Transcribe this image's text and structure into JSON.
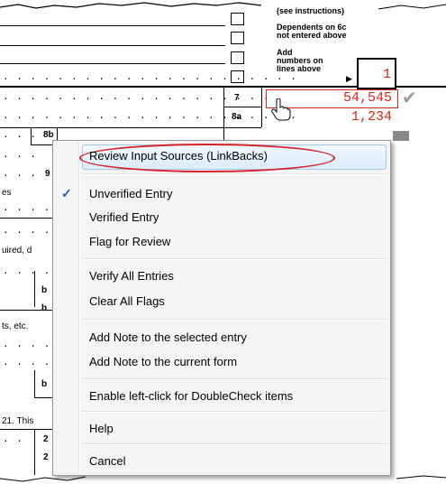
{
  "form": {
    "header_note": "(see instructions)",
    "dependents_note": "Dependents on 6c not entered above",
    "add_numbers_note": "Add numbers on lines above",
    "total_value": "1",
    "line7_label": "7",
    "line7_value": "54,545",
    "line8a_label": "8a",
    "line8a_value": "1,234",
    "line8b_label": "8b",
    "line9_label": "9",
    "fragment_es": "es",
    "fragment_uired": "uired, d",
    "fragment_b1": "b",
    "fragment_b2": "b",
    "fragment_ts": "ts, etc.",
    "fragment_b3": "b",
    "fragment_21": "21. This",
    "fragment_2a": "2",
    "fragment_2b": "2",
    "colors": {
      "entry_red": "#d9261c",
      "menu_border": "#979797",
      "callout_red": "#d2232a"
    }
  },
  "context_menu": {
    "items": [
      {
        "label": "Review Input Sources (LinkBacks)",
        "highlighted": true
      },
      {
        "label": "Unverified Entry",
        "checked": true
      },
      {
        "label": "Verified Entry"
      },
      {
        "label": "Flag for Review"
      },
      {
        "label": "Verify All Entries"
      },
      {
        "label": "Clear All Flags"
      },
      {
        "label": "Add Note to the selected entry"
      },
      {
        "label": "Add Note to the current form"
      },
      {
        "label": "Enable left-click for DoubleCheck items"
      },
      {
        "label": "Help"
      },
      {
        "label": "Cancel"
      }
    ],
    "check_icon": "checkmark-icon"
  },
  "icons": {
    "cursor": "hand-pointer-icon",
    "verified_mark": "gray-checkmark-icon"
  }
}
